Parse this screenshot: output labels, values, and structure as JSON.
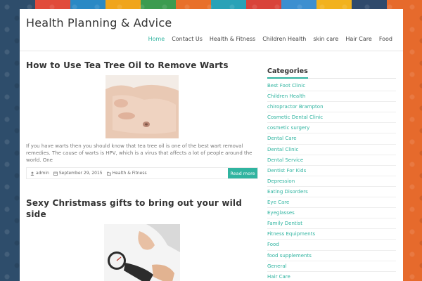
{
  "site": {
    "title": "Health Planning & Advice"
  },
  "background": {
    "colors": [
      "#2e4d6b",
      "#e14b3b",
      "#2a89c5",
      "#f0a51c",
      "#3c9b50",
      "#e8702a",
      "#29a2b7",
      "#d9433a",
      "#3d8fd0",
      "#f2b21e",
      "#2f4a6c",
      "#e66a2c"
    ]
  },
  "accent": "#30b4a0",
  "nav": {
    "items": [
      {
        "label": "Home"
      },
      {
        "label": "Contact Us"
      },
      {
        "label": "Health & Fitness"
      },
      {
        "label": "Children Health"
      },
      {
        "label": "skin care"
      },
      {
        "label": "Hair Care"
      },
      {
        "label": "Food"
      }
    ]
  },
  "posts": [
    {
      "title": "How to Use Tea Tree Oil to Remove Warts",
      "image_icon": "foot-photo",
      "excerpt": "If you have warts then you should know that tea tree oil is one of the best wart removal remedies. The cause of warts is HPV, which is a virus that affects a lot of people around the world. One",
      "author": "admin",
      "date": "September 29, 2015",
      "category": "Health & Fitness",
      "read_more": "Read more"
    },
    {
      "title": "Sexy Christmass gifts to bring out your wild side",
      "image_icon": "blood-pressure-photo"
    }
  ],
  "sidebar": {
    "title": "Categories",
    "items": [
      "Best Foot Clinic",
      "Children Health",
      "chiropractor Brampton",
      "Cosmetic Dental Clinic",
      "cosmetic surgery",
      "Dental Care",
      "Dental Clinic",
      "Dental Service",
      "Dentist For Kids",
      "Depression",
      "Eating Disorders",
      "Eye Care",
      "Eyeglasses",
      "Family Dentist",
      "Fitness Equipments",
      "Food",
      "food supplements",
      "General",
      "Hair Care"
    ]
  }
}
